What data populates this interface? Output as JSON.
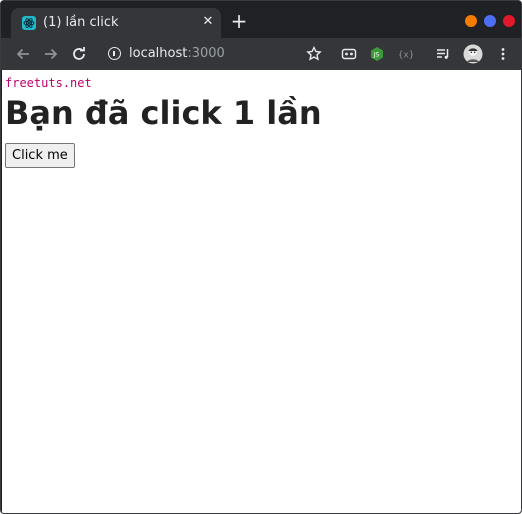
{
  "browser": {
    "tab": {
      "title": "(1) lần click",
      "close_glyph": "✕",
      "favicon": "react-icon"
    },
    "new_tab_glyph": "+",
    "window_controls": {
      "minimize_color": "#f57c00",
      "maximize_color": "#4c6ef5",
      "close_color": "#e0192a"
    },
    "address": {
      "host": "localhost",
      "port": ":3000"
    },
    "toolbar_icons": [
      "bookmark-star-icon",
      "extension-icon",
      "nodejs-icon",
      "code-extension-icon",
      "media-queue-icon",
      "profile-avatar-icon",
      "menu-icon"
    ]
  },
  "page": {
    "brand": "freetuts.net",
    "heading": "Bạn đã click 1 lần",
    "button_label": "Click me"
  }
}
